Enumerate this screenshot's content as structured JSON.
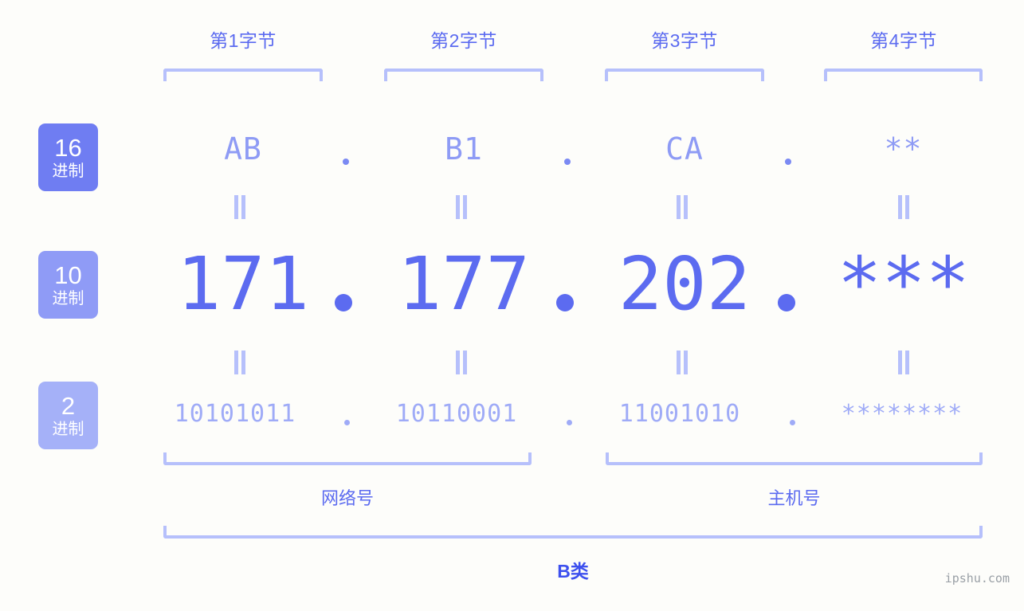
{
  "background_color": "#fdfdfa",
  "accent_color": "#5c6bf0",
  "byte_headers": [
    {
      "label": "第1字节"
    },
    {
      "label": "第2字节"
    },
    {
      "label": "第3字节"
    },
    {
      "label": "第4字节"
    }
  ],
  "bases": [
    {
      "number": "16",
      "suffix": "进制",
      "color": "#6f7df2"
    },
    {
      "number": "10",
      "suffix": "进制",
      "color": "#8f9bf6"
    },
    {
      "number": "2",
      "suffix": "进制",
      "color": "#a5b1f8"
    }
  ],
  "rows": {
    "hex": {
      "values": [
        "AB",
        "B1",
        "CA",
        "**"
      ],
      "separator": "."
    },
    "decimal": {
      "values": [
        "171",
        "177",
        "202",
        "***"
      ],
      "separator": "."
    },
    "binary": {
      "values": [
        "10101011",
        "10110001",
        "11001010",
        "********"
      ],
      "separator": "."
    }
  },
  "connectors": {
    "symbol": "‖",
    "rows": [
      "hex-to-decimal",
      "decimal-to-binary"
    ]
  },
  "sections": [
    {
      "label": "网络号"
    },
    {
      "label": "主机号"
    }
  ],
  "ip_class": {
    "label": "B类"
  },
  "watermark": {
    "text": "ipshu.com"
  }
}
